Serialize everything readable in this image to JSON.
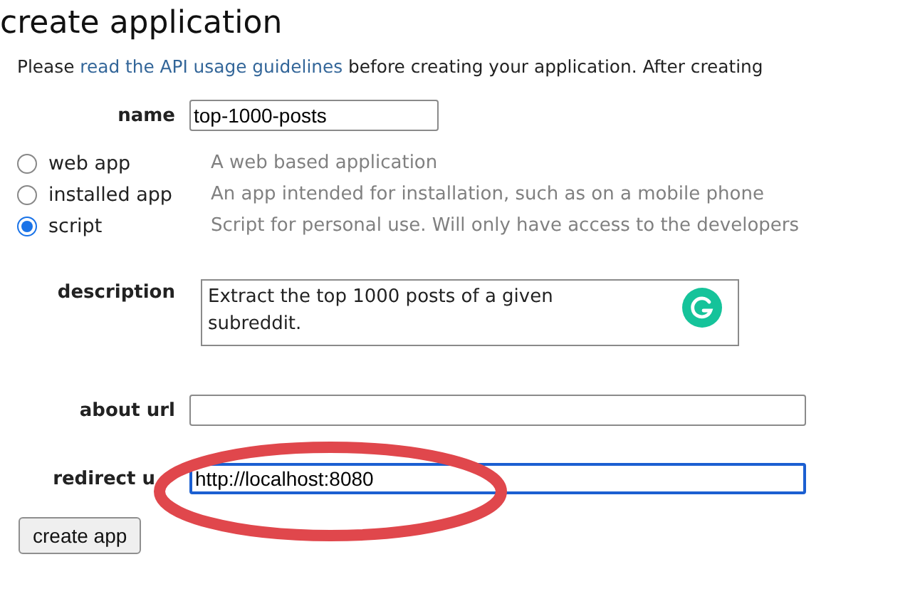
{
  "heading": "create application",
  "intro": {
    "before": "Please ",
    "link": "read the API usage guidelines",
    "after": " before creating your application. After creating"
  },
  "name_field": {
    "label": "name",
    "value": "top-1000-posts"
  },
  "app_types": [
    {
      "label": "web app",
      "description": "A web based application",
      "selected": false
    },
    {
      "label": "installed app",
      "description": "An app intended for installation, such as on a mobile phone",
      "selected": false
    },
    {
      "label": "script",
      "description": "Script for personal use. Will only have access to the developers",
      "selected": true
    }
  ],
  "description_field": {
    "label": "description",
    "value": "Extract the top 1000 posts of a given subreddit."
  },
  "about_url_field": {
    "label": "about url"
  },
  "redirect_url_field": {
    "label": "redirect u",
    "value": "http://localhost:8080",
    "focused": true
  },
  "submit_button": "create app"
}
